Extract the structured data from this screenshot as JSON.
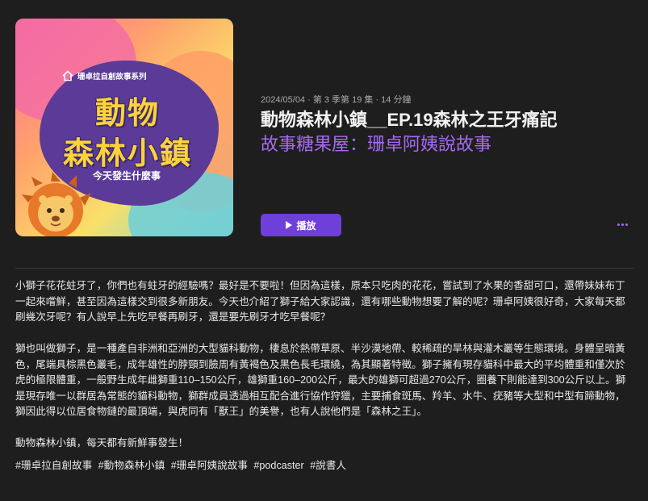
{
  "artwork": {
    "series_label": "珊卓拉自創故事系列",
    "title_line1": "動物",
    "title_line2": "森林小鎮",
    "subtitle": "今天發生什麼事"
  },
  "episode": {
    "meta": "2024/05/04 · 第 3 季第 19 集 · 14 分鐘",
    "title": "動物森林小鎮__EP.19森林之王牙痛記",
    "show": "故事糖果屋：珊卓阿姨說故事"
  },
  "actions": {
    "play_label": "播放"
  },
  "description": {
    "paragraphs": [
      "小獅子花花蛀牙了，你們也有蛀牙的經驗嗎？最好是不要啦！但因為這樣，原本只吃肉的花花，嘗試到了水果的香甜可口，還帶妹妹布丁一起來嚐鮮，甚至因為這樣交到很多新朋友。今天也介紹了獅子給大家認識，還有哪些動物想要了解的呢？珊卓阿姨很好奇，大家每天都刷幾次牙呢？有人說早上先吃早餐再刷牙，還是要先刷牙才吃早餐呢？",
      "獅也叫做獅子，是一種產自非洲和亞洲的大型貓科動物，棲息於熱帶草原、半沙漠地帶、較稀疏的旱林與灌木叢等生態環境。身體呈暗黃色，尾端具棕黑色叢毛，成年雄性的脖頸到臉周有黃褐色及黑色長毛環繞，為其顯著特徵。獅子擁有現存貓科中最大的平均體重和僅次於虎的極限體重，一般野生成年雌獅重110–150公斤，雄獅重160–200公斤，最大的雄獅可超過270公斤，圈養下則能達到300公斤以上。獅是現存唯一以群居為常態的貓科動物，獅群成員透過相互配合進行協作狩獵，主要捕食斑馬、羚羊、水牛、疣豬等大型和中型有蹄動物，獅因此得以位居食物鏈的最頂端，與虎同有「獸王」的美譽，也有人說他們是「森林之王」。",
      "動物森林小鎮，每天都有新鮮事發生！"
    ],
    "hashtags": [
      "#珊卓拉自創故事",
      "#動物森林小鎮",
      "#珊卓阿姨說故事",
      "#podcaster",
      "#說書人"
    ]
  },
  "icons": {
    "play": "play-icon",
    "more": "more-icon",
    "home": "house-icon"
  },
  "colors": {
    "accent": "#a66bf0",
    "play_button": "#6f3fd9",
    "background": "#1e1e1f"
  }
}
